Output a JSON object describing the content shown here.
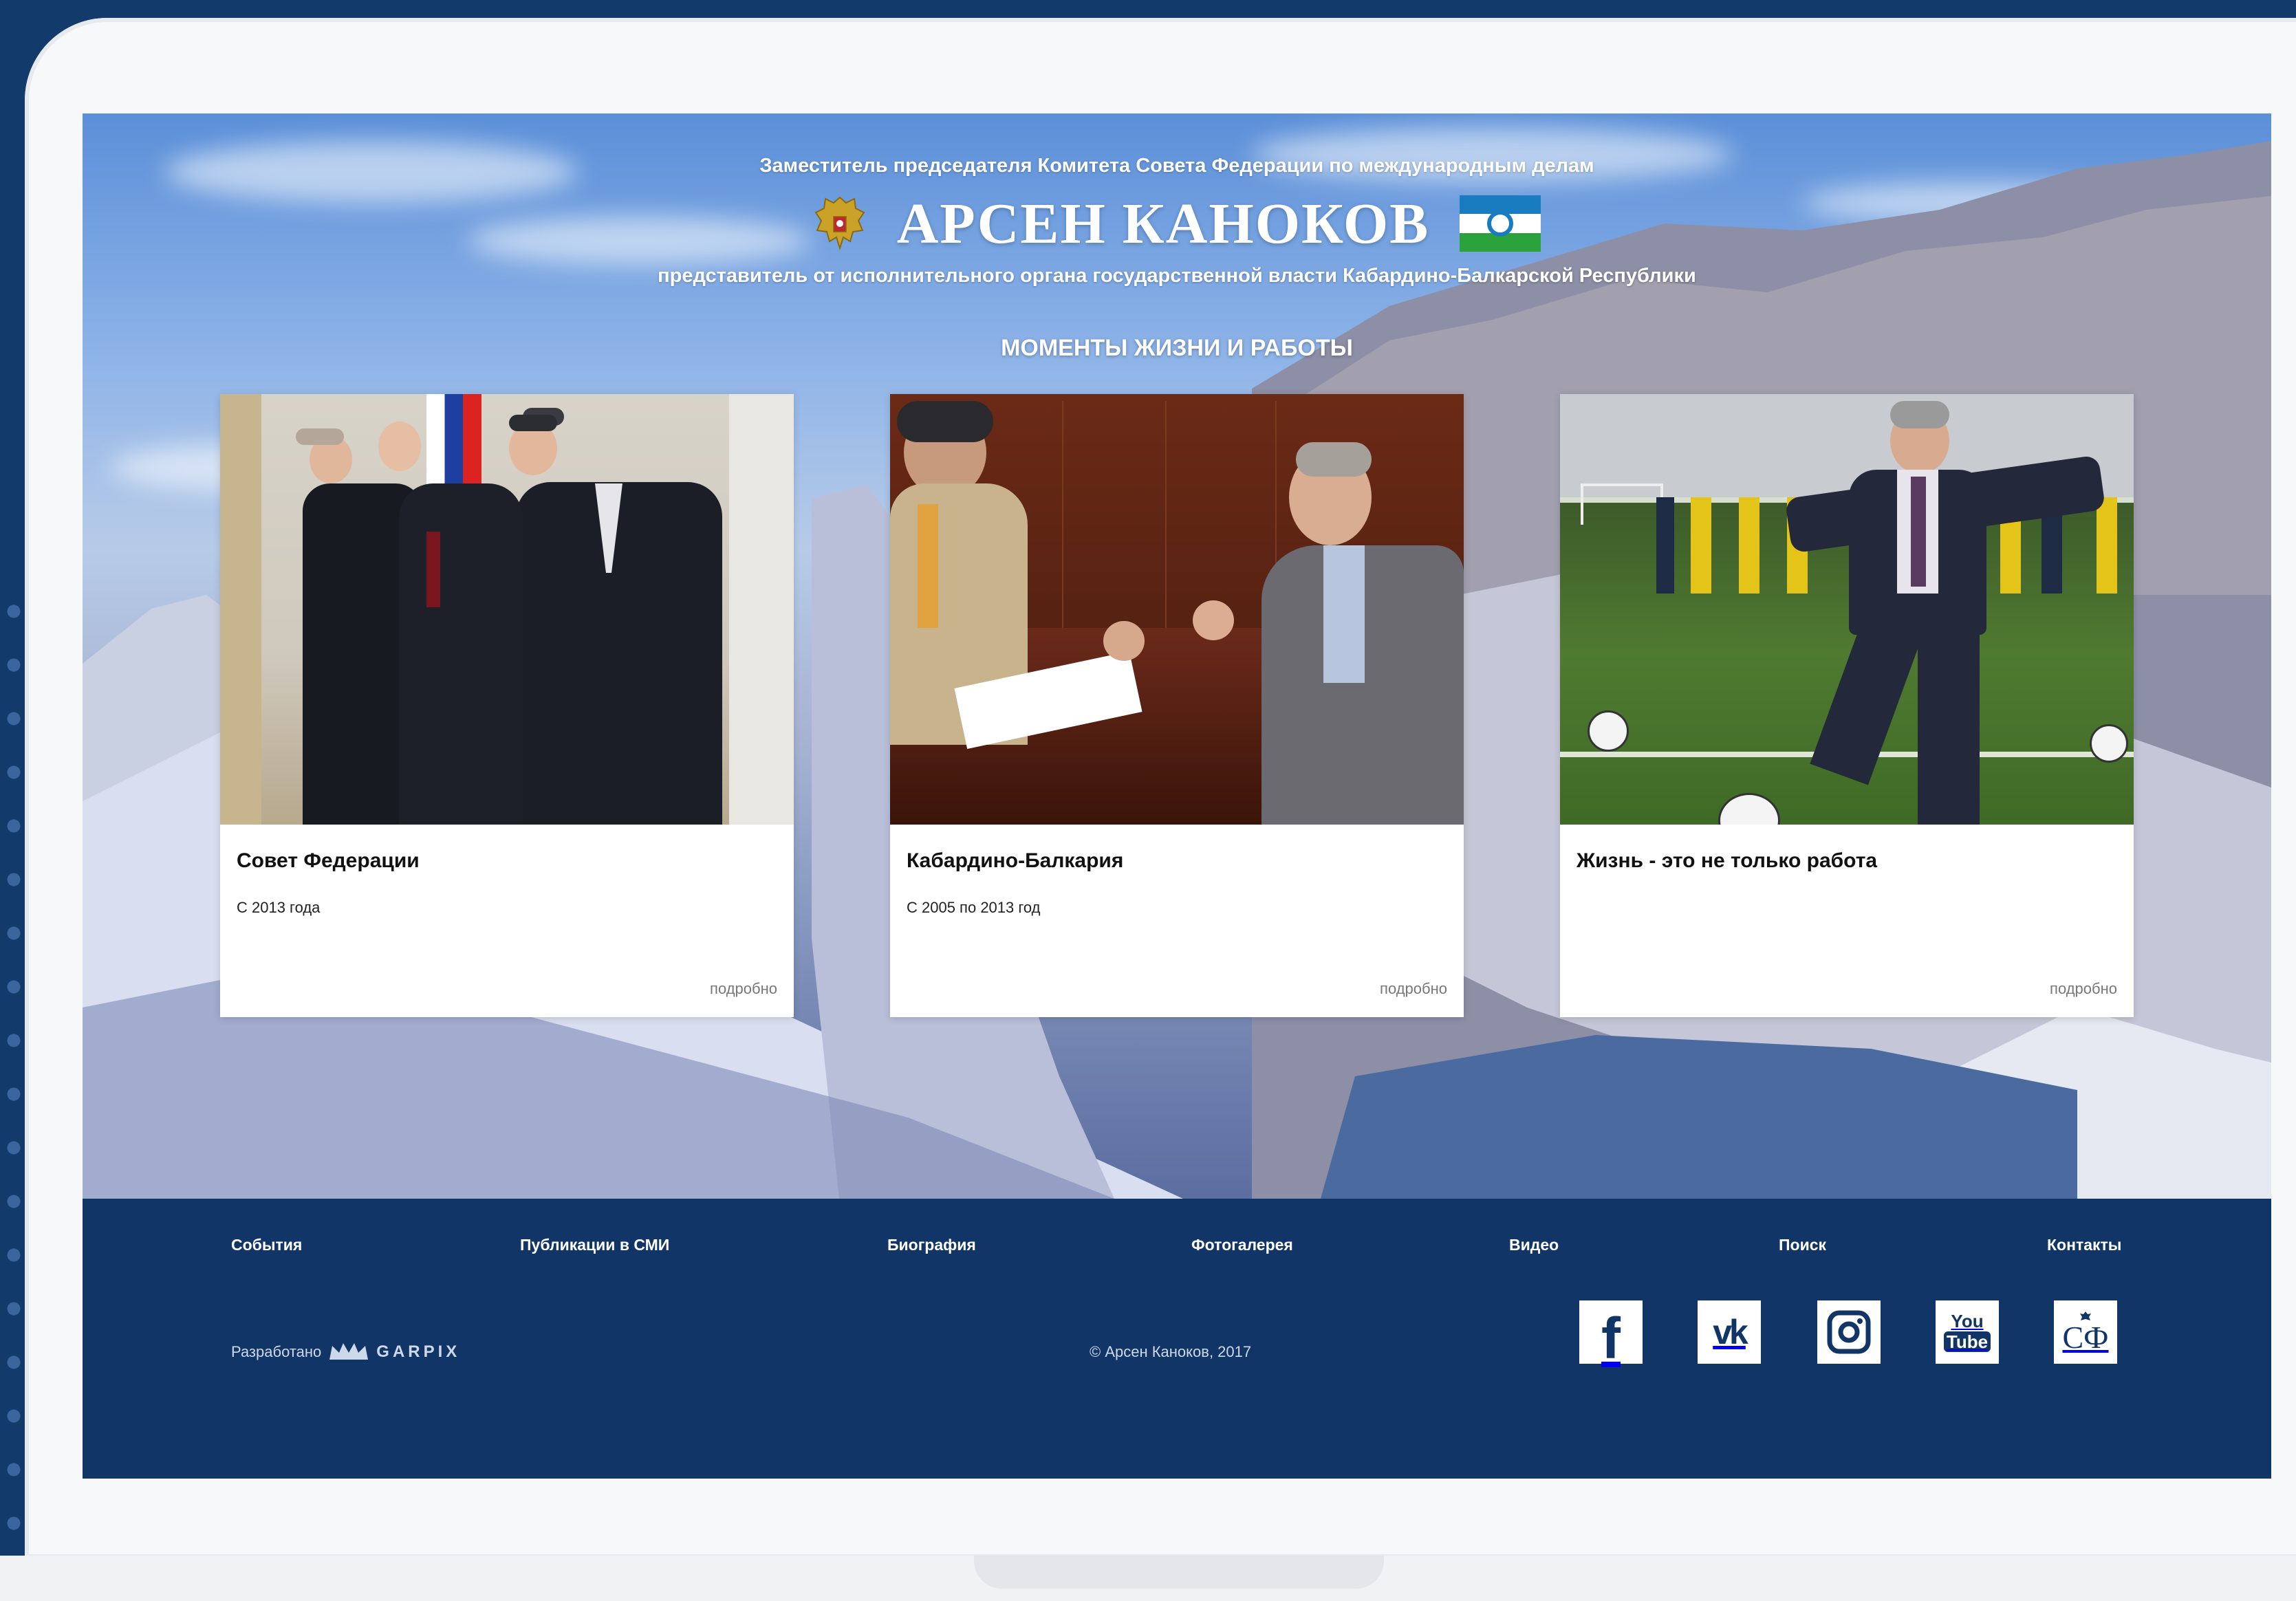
{
  "header": {
    "position_title": "Заместитель председателя Комитета Совета Федерации по международным делам",
    "name": "АРСЕН КАНОКОВ",
    "representative": "представитель от исполнительного органа государственной власти Кабардино-Балкарской Республики"
  },
  "section": {
    "title": "МОМЕНТЫ ЖИЗНИ И РАБОТЫ"
  },
  "cards": [
    {
      "title": "Совет Федерации",
      "date": "С 2013 года",
      "more": "подробно"
    },
    {
      "title": "Кабардино-Балкария",
      "date": "С 2005 по 2013 год",
      "more": "подробно"
    },
    {
      "title": "Жизнь - это не только работа",
      "date": "",
      "more": "подробно"
    }
  ],
  "footer": {
    "nav": [
      {
        "label": "События"
      },
      {
        "label": "Публикации в СМИ"
      },
      {
        "label": "Биография"
      },
      {
        "label": "Фотогалерея"
      },
      {
        "label": "Видео"
      },
      {
        "label": "Поиск"
      },
      {
        "label": "Контакты"
      }
    ],
    "developed_by": "Разработано",
    "developer": "GARPIX",
    "copyright": "© Арсен Каноков, 2017",
    "social": [
      {
        "icon": "facebook-icon",
        "glyph": "f"
      },
      {
        "icon": "vk-icon",
        "glyph": "vk"
      },
      {
        "icon": "instagram-icon",
        "glyph": ""
      },
      {
        "icon": "youtube-icon",
        "glyph_top": "You",
        "glyph_bottom": "Tube"
      },
      {
        "icon": "council-federation-icon",
        "glyph": "СФ"
      }
    ]
  },
  "colors": {
    "footer_bg": "#123568",
    "page_bg": "#123a6b",
    "flag_top": "#1a7cc0",
    "flag_middle": "#ffffff",
    "flag_bottom": "#2aa13a"
  }
}
